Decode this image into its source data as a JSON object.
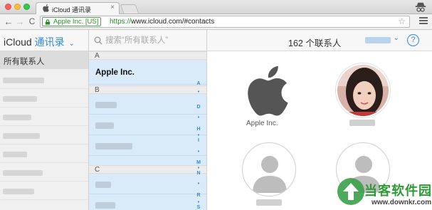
{
  "browser": {
    "tab_title": "iCloud 通讯录",
    "tab_close": "×",
    "ev_label": "Apple Inc. [US]",
    "url_scheme": "https://",
    "url_rest": "www.icloud.com/#contacts",
    "nav": {
      "back": "←",
      "forward": "→",
      "reload": "C"
    },
    "star": "☆"
  },
  "header": {
    "brand": "iCloud",
    "app_name": "通讯录",
    "brand_chevron": "⌄",
    "search_placeholder": "搜索“所有联系人”",
    "contact_count": "162 个联系人",
    "account_chevron": "⌄",
    "help": "?"
  },
  "groups": {
    "selected": "所有联系人"
  },
  "contacts": {
    "sections": [
      {
        "letter": "A"
      },
      {
        "letter": "B"
      },
      {
        "letter": "C"
      }
    ],
    "first_contact": "Apple Inc.",
    "index_letters": [
      "A",
      "•",
      "D",
      "•",
      "H",
      "•",
      "I",
      "•",
      "M",
      "•",
      "N",
      "•",
      "R",
      "•",
      "S"
    ]
  },
  "grid": {
    "apple_card_label": "Apple Inc."
  },
  "watermark": {
    "title": "当客软件园",
    "url": "www.downkr.com"
  },
  "colors": {
    "accent": "#2f8ad8",
    "list_bg": "#d9ebf9",
    "watermark_green": "#2f9a36"
  },
  "icons": [
    "apple-logo-icon",
    "close-icon",
    "incognito-icon",
    "lock-icon",
    "star-icon",
    "menu-icon",
    "search-icon",
    "help-icon",
    "silhouette-icon"
  ]
}
